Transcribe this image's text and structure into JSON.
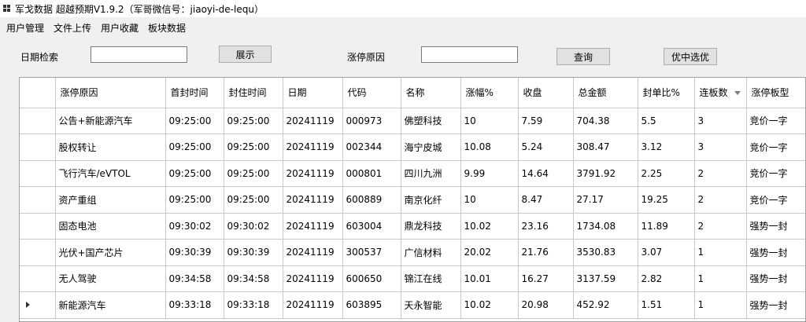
{
  "window": {
    "title": "军戈数据 超越预期V1.9.2（军哥微信号：jiaoyi-de-lequ）"
  },
  "menu": [
    {
      "label": "用户管理"
    },
    {
      "label": "文件上传"
    },
    {
      "label": "用户收藏"
    },
    {
      "label": "板块数据"
    }
  ],
  "search": {
    "date_label": "日期检索",
    "date_value": "",
    "show_button": "展示",
    "reason_label": "涨停原因",
    "reason_value": "",
    "query_button": "查询",
    "select_button": "优中选优"
  },
  "table": {
    "columns": [
      "涨停原因",
      "首封时间",
      "封住时间",
      "日期",
      "代码",
      "名称",
      "涨幅%",
      "收盘",
      "总金额",
      "封单比%",
      "连板数",
      "涨停板型"
    ],
    "rows": [
      [
        "公告+新能源汽车",
        "09:25:00",
        "09:25:00",
        "20241119",
        "000973",
        "佛塑科技",
        "10",
        "7.59",
        "704.38",
        "5.5",
        "3",
        "竞价一字"
      ],
      [
        "股权转让",
        "09:25:00",
        "09:25:00",
        "20241119",
        "002344",
        "海宁皮城",
        "10.08",
        "5.24",
        "308.47",
        "3.12",
        "3",
        "竞价一字"
      ],
      [
        "飞行汽车/eVTOL",
        "09:25:00",
        "09:25:00",
        "20241119",
        "000801",
        "四川九洲",
        "9.99",
        "14.64",
        "3791.92",
        "2.25",
        "2",
        "竞价一字"
      ],
      [
        "资产重组",
        "09:25:00",
        "09:25:00",
        "20241119",
        "600889",
        "南京化纤",
        "10",
        "8.47",
        "27.17",
        "19.25",
        "2",
        "竞价一字"
      ],
      [
        "固态电池",
        "09:30:02",
        "09:30:02",
        "20241119",
        "603004",
        "鼎龙科技",
        "10.02",
        "23.16",
        "1734.08",
        "11.89",
        "2",
        "强势一封"
      ],
      [
        "光伏+国产芯片",
        "09:30:39",
        "09:30:39",
        "20241119",
        "300537",
        "广信材料",
        "20.02",
        "21.76",
        "3530.83",
        "3.07",
        "1",
        "强势一封"
      ],
      [
        "无人驾驶",
        "09:34:58",
        "09:34:58",
        "20241119",
        "600650",
        "锦江在线",
        "10.01",
        "16.27",
        "3137.59",
        "2.82",
        "1",
        "强势一封"
      ],
      [
        "新能源汽车",
        "09:33:18",
        "09:33:18",
        "20241119",
        "603895",
        "天永智能",
        "10.02",
        "20.98",
        "452.92",
        "1.51",
        "1",
        "强势一封"
      ]
    ]
  }
}
